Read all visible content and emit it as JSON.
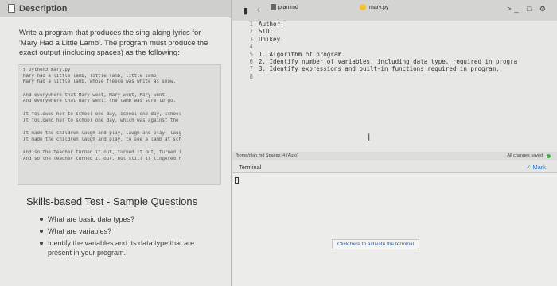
{
  "left": {
    "tab_label": "Description",
    "paragraph": "Write a program that produces the sing-along lyrics for 'Mary Had a Little Lamb'. The program must produce the exact output (including spaces) as the following:",
    "code_lines": [
      "$ python3 mary.py",
      "Mary had a little lamb, little lamb, little lamb,",
      "Mary had a little lamb, whose fleece was white as snow.",
      "",
      "And everywhere that Mary went, Mary went, Mary went,",
      "And everywhere that Mary went, the lamb was sure to go.",
      "",
      "It followed her to school one day, school one day, school",
      "It followed her to school one day, which was against the",
      "",
      "It made the children laugh and play, laugh and play, laug",
      "It made the children laugh and play, to see a lamb at sch",
      "",
      "And so the teacher turned it out, turned it out, turned i",
      "And so the teacher turned it out, but still it lingered n"
    ],
    "skills_title": "Skills-based Test - Sample Questions",
    "bullets": [
      "What are basic data types?",
      "What are variables?",
      "Identify the variables and its data type that are present in your program."
    ]
  },
  "editor": {
    "add_symbol": "+",
    "tabs": [
      {
        "label": "plan.md"
      },
      {
        "label": "mary.py"
      }
    ],
    "line_numbers": [
      "1",
      "2",
      "3",
      "4",
      "5",
      "6",
      "7",
      "8"
    ],
    "code_lines": [
      "Author:",
      "SID:",
      "Unikey:",
      "",
      "1. Algorithm of program.",
      "2. Identify number of variables, including data type, required in progra",
      "3. Identify expressions and built-in functions required in program.",
      ""
    ]
  },
  "status": {
    "path": "/home/plan.md  Spaces: 4 (Auto)",
    "saved": "All changes saved"
  },
  "terminal": {
    "tab_label": "Terminal",
    "mark_label": "✓ Mark",
    "activate_label": "Click here to activate the terminal"
  }
}
